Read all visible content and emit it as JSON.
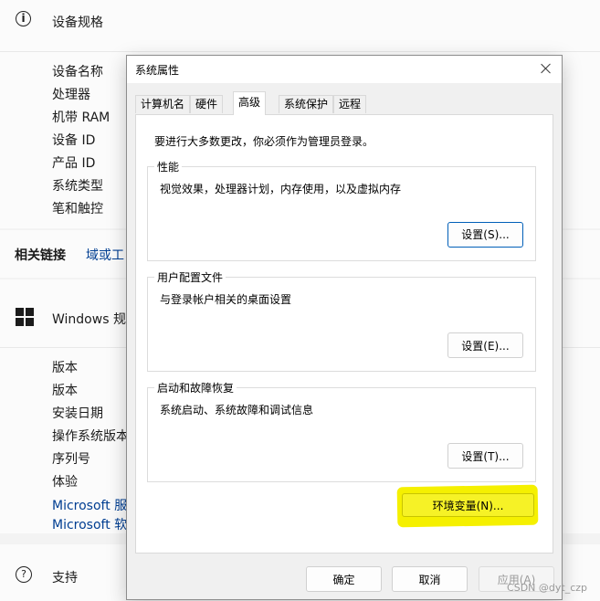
{
  "background": {
    "spec_section": {
      "title": "设备规格",
      "icon": "info-icon",
      "rows": [
        "设备名称",
        "处理器",
        "机带 RAM",
        "设备 ID",
        "产品 ID",
        "系统类型",
        "笔和触控"
      ]
    },
    "related_links": {
      "title": "相关链接",
      "link": "域或工"
    },
    "windows_section": {
      "title": "Windows 规格",
      "icon": "windows-logo-icon",
      "rows": [
        "版本",
        "版本",
        "安装日期",
        "操作系统版本",
        "序列号",
        "体验"
      ],
      "links": [
        "Microsoft 服务",
        "Microsoft 软件"
      ]
    },
    "support_section": {
      "title": "支持",
      "icon": "help-icon"
    },
    "watermark": "CSDN @dyt_czp"
  },
  "dialog": {
    "title": "系统属性",
    "tabs": [
      {
        "label": "计算机名",
        "active": false
      },
      {
        "label": "硬件",
        "active": false
      },
      {
        "label": "高级",
        "active": true
      },
      {
        "label": "系统保护",
        "active": false
      },
      {
        "label": "远程",
        "active": false
      }
    ],
    "notice": "要进行大多数更改，你必须作为管理员登录。",
    "groups": [
      {
        "title": "性能",
        "desc": "视觉效果，处理器计划，内存使用，以及虚拟内存",
        "button": "设置(S)..."
      },
      {
        "title": "用户配置文件",
        "desc": "与登录帐户相关的桌面设置",
        "button": "设置(E)..."
      },
      {
        "title": "启动和故障恢复",
        "desc": "系统启动、系统故障和调试信息",
        "button": "设置(T)..."
      }
    ],
    "env_button": "环境变量(N)...",
    "footer": {
      "ok": "确定",
      "cancel": "取消",
      "apply": "应用(A)"
    },
    "highlight_color": "#f5f000",
    "accent_color": "#005fb8"
  }
}
